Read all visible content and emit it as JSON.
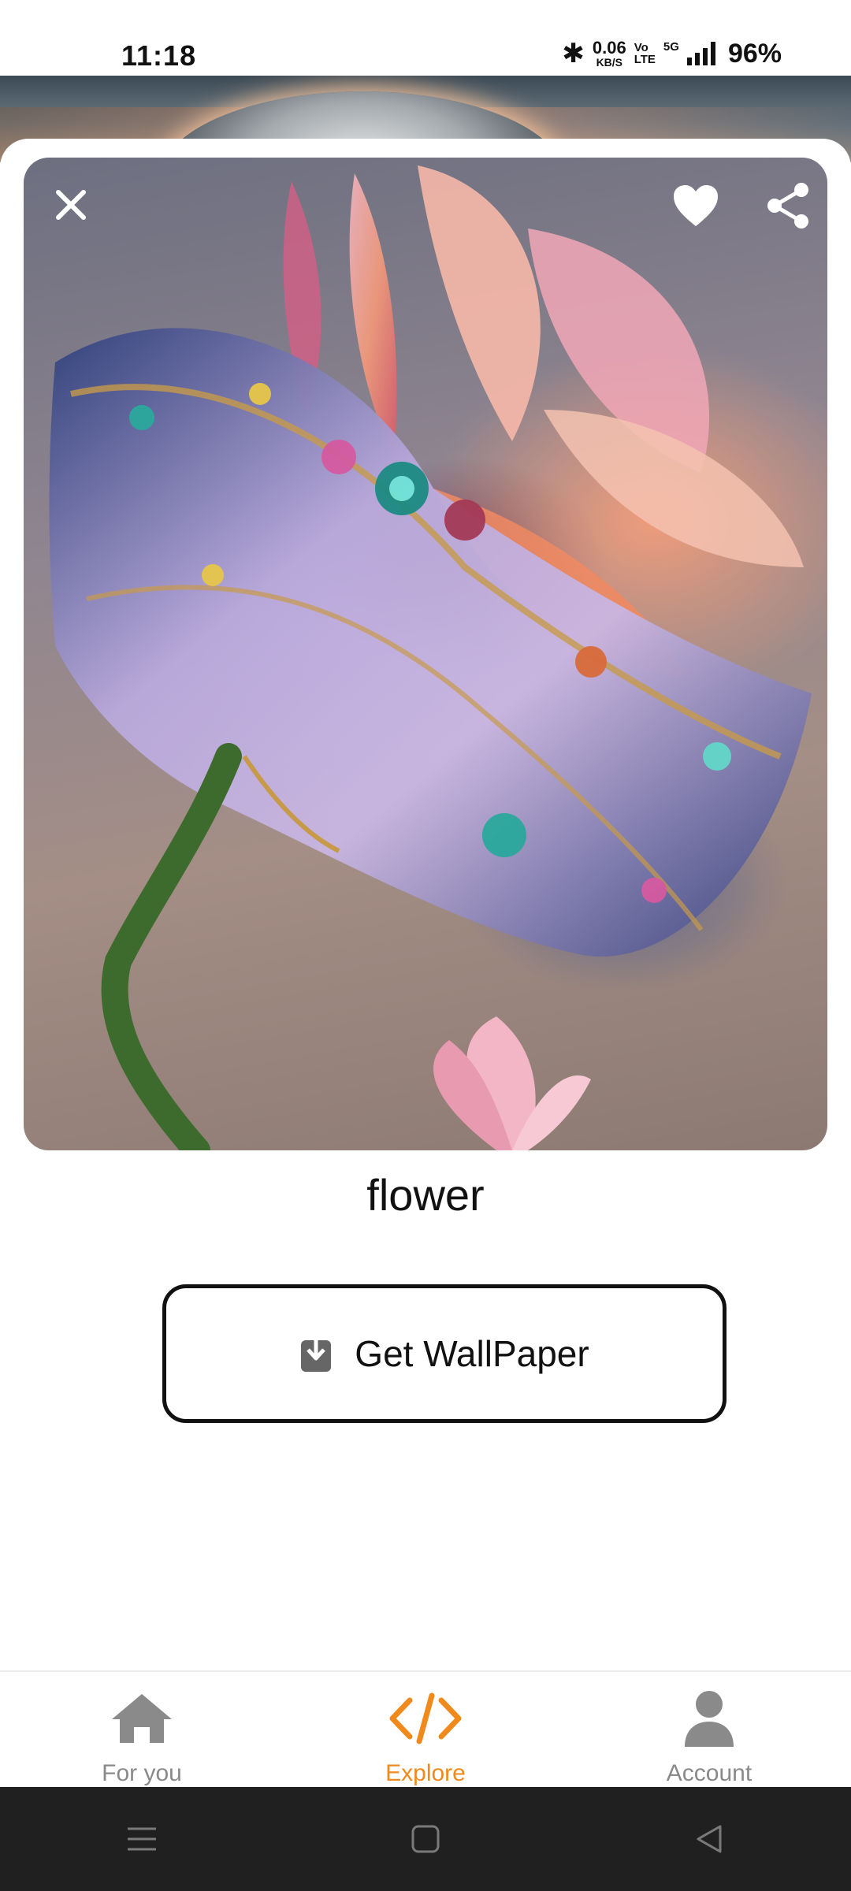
{
  "status_bar": {
    "time": "11:18",
    "bluetooth": "✱",
    "net_speed_value": "0.06",
    "net_speed_unit": "KB/S",
    "volte_top": "Vo",
    "volte_bottom": "LTE",
    "network_type": "5G",
    "battery": "96%"
  },
  "preview": {
    "close_icon": "close-icon",
    "favorite_icon": "heart-icon",
    "share_icon": "share-icon"
  },
  "wallpaper": {
    "title": "flower",
    "button_label": "Get WallPaper",
    "button_icon": "download-icon"
  },
  "bottom_nav": {
    "items": [
      {
        "label": "For you",
        "icon": "home-icon",
        "active": false
      },
      {
        "label": "Explore",
        "icon": "code-icon",
        "active": true
      },
      {
        "label": "Account",
        "icon": "person-icon",
        "active": false
      }
    ],
    "active_color": "#f08a1c",
    "inactive_color": "#8a8a8a"
  },
  "system_nav": {
    "buttons": [
      "menu-icon",
      "home-square-icon",
      "back-triangle-icon"
    ]
  }
}
